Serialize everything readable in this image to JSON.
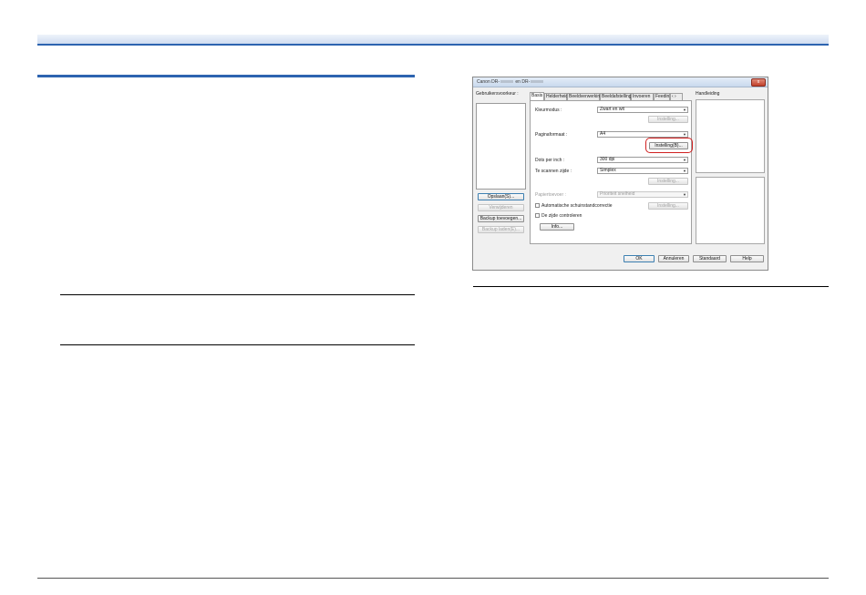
{
  "dialog": {
    "title_prefix": "Canon DR-",
    "title_mid": " en DR-",
    "close_label": "x",
    "user_prefs_label": "Gebruikersvoorkeur :",
    "buttons_left": {
      "save": "Opslaan(S)...",
      "delete": "Verwijderen",
      "backup_add": "Backup toevoegen...",
      "backup_restore": "Backup laden(E)..."
    },
    "tabs": [
      "Basis",
      "Helderheid",
      "Beeldverwerking",
      "Beeldafstelling",
      "Invoeren",
      "Feedin"
    ],
    "tab_scroll": "‹ ›",
    "help_label": "Handleiding",
    "fields": {
      "color_mode": {
        "label": "Kleurmodus :",
        "value": "Zwart en wit",
        "settings_btn": "Instelling..."
      },
      "page_size": {
        "label": "Paginaformaat :",
        "value": "A4",
        "settings_btn": "Instelling(B)..."
      },
      "dpi": {
        "label": "Dots per inch :",
        "value": "300 dpi"
      },
      "scanning_side": {
        "label": "Te scannen zijde :",
        "value": "Simplex",
        "settings_btn": "Instelling..."
      },
      "feeding": {
        "label": "Papiertoevoer :",
        "value": "Prioriteit snelheid"
      },
      "deskew": {
        "label": "Automatische schuinstandcorrectie",
        "settings_btn": "Instelling..."
      },
      "check_side": {
        "label": "De zijde controleren"
      },
      "info_btn": "Info..."
    },
    "footer": {
      "ok": "OK",
      "cancel": "Annuleren",
      "default": "Standaard",
      "help": "Help"
    }
  }
}
